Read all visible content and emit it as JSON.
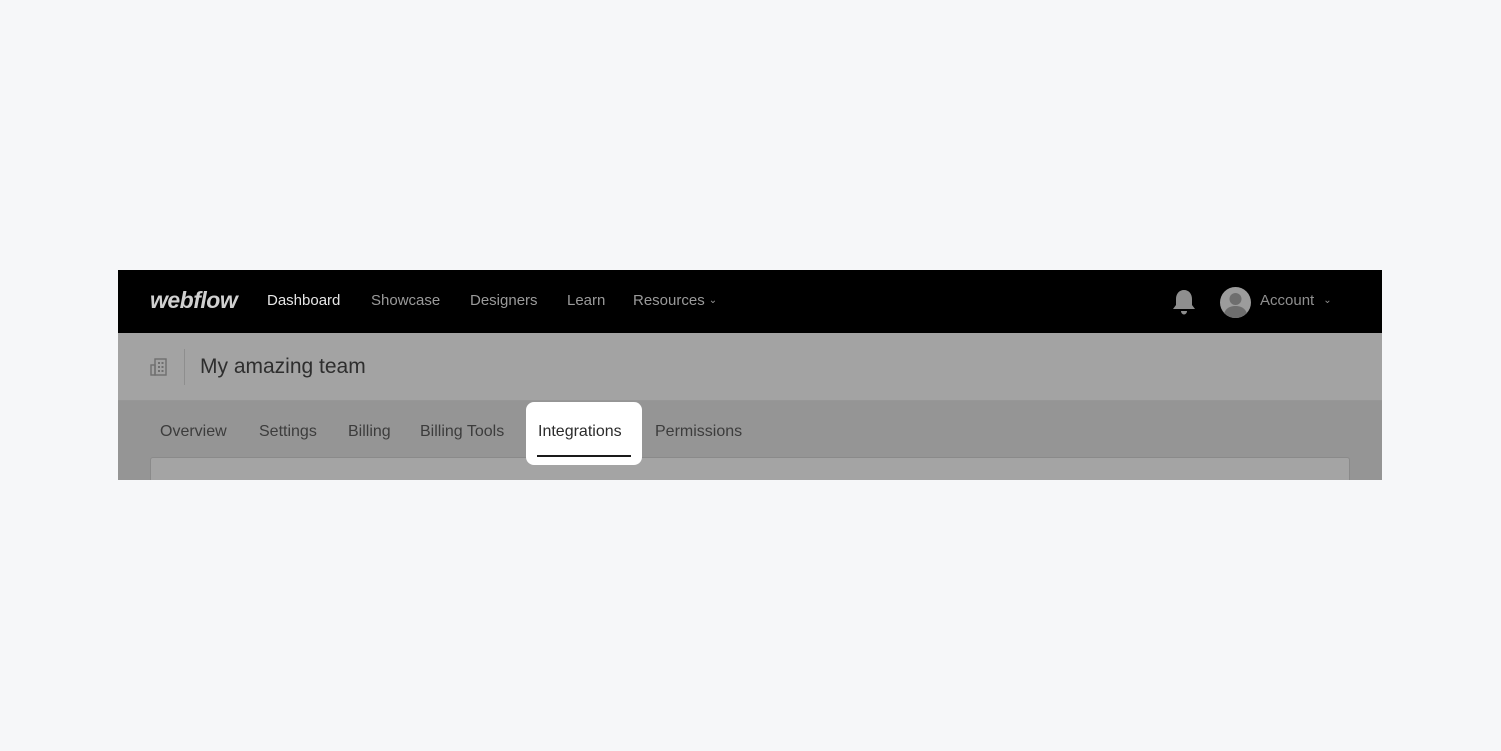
{
  "app": {
    "logo": "webflow"
  },
  "nav": {
    "items": [
      {
        "label": "Dashboard",
        "active": true
      },
      {
        "label": "Showcase",
        "active": false
      },
      {
        "label": "Designers",
        "active": false
      },
      {
        "label": "Learn",
        "active": false
      },
      {
        "label": "Resources",
        "active": false
      }
    ],
    "account_label": "Account"
  },
  "team": {
    "name": "My amazing team"
  },
  "tabs": {
    "items": [
      {
        "label": "Overview"
      },
      {
        "label": "Settings"
      },
      {
        "label": "Billing"
      },
      {
        "label": "Billing Tools"
      },
      {
        "label": "Integrations",
        "active": true
      },
      {
        "label": "Permissions"
      }
    ]
  },
  "icons": {
    "notifications": "bell-icon",
    "avatar": "user-avatar-icon",
    "team": "building-icon",
    "dropdown": "chevron-down-icon"
  },
  "colors": {
    "nav_background": "#000000",
    "page_background": "#f6f7f9",
    "active_tab_background": "#ffffff",
    "active_tab_underline": "#1a1a1a"
  }
}
